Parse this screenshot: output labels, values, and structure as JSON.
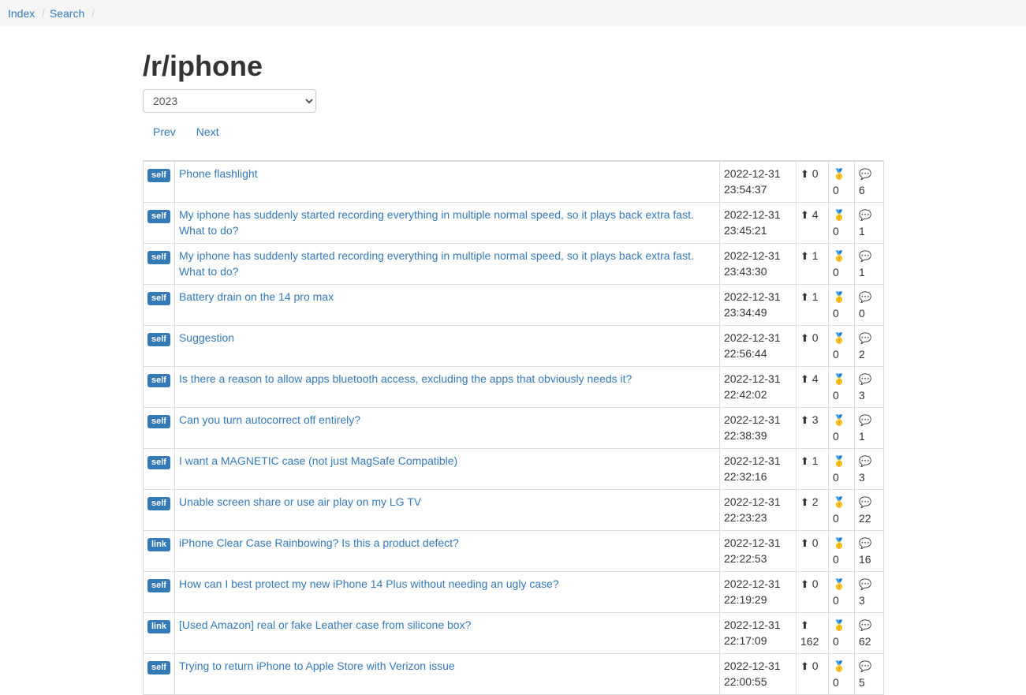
{
  "nav": {
    "index": "Index",
    "search": "Search"
  },
  "page": {
    "title": "/r/iphone",
    "year_selected": "2023",
    "prev": "Prev",
    "next": "Next"
  },
  "icons": {
    "score": "⬆",
    "awards": "🥇",
    "comments": "💬"
  },
  "posts": [
    {
      "kind": "self",
      "title": "Phone flashlight",
      "date": "2022-12-31",
      "time": "23:54:37",
      "score": "0",
      "awards": "0",
      "comments": "6"
    },
    {
      "kind": "self",
      "title": "My iphone has suddenly started recording everything in multiple normal speed, so it plays back extra fast. What to do?",
      "date": "2022-12-31",
      "time": "23:45:21",
      "score": "4",
      "awards": "0",
      "comments": "1"
    },
    {
      "kind": "self",
      "title": "My iphone has suddenly started recording everything in multiple normal speed, so it plays back extra fast. What to do?",
      "date": "2022-12-31",
      "time": "23:43:30",
      "score": "1",
      "awards": "0",
      "comments": "1"
    },
    {
      "kind": "self",
      "title": "Battery drain on the 14 pro max",
      "date": "2022-12-31",
      "time": "23:34:49",
      "score": "1",
      "awards": "0",
      "comments": "0"
    },
    {
      "kind": "self",
      "title": "Suggestion",
      "date": "2022-12-31",
      "time": "22:56:44",
      "score": "0",
      "awards": "0",
      "comments": "2"
    },
    {
      "kind": "self",
      "title": "Is there a reason to allow apps bluetooth access, excluding the apps that obviously needs it?",
      "date": "2022-12-31",
      "time": "22:42:02",
      "score": "4",
      "awards": "0",
      "comments": "3"
    },
    {
      "kind": "self",
      "title": "Can you turn autocorrect off entirely?",
      "date": "2022-12-31",
      "time": "22:38:39",
      "score": "3",
      "awards": "0",
      "comments": "1"
    },
    {
      "kind": "self",
      "title": "I want a MAGNETIC case (not just MagSafe Compatible)",
      "date": "2022-12-31",
      "time": "22:32:16",
      "score": "1",
      "awards": "0",
      "comments": "3"
    },
    {
      "kind": "self",
      "title": "Unable screen share or use air play on my LG TV",
      "date": "2022-12-31",
      "time": "22:23:23",
      "score": "2",
      "awards": "0",
      "comments": "22"
    },
    {
      "kind": "link",
      "title": "iPhone Clear Case Rainbowing? Is this a product defect?",
      "date": "2022-12-31",
      "time": "22:22:53",
      "score": "0",
      "awards": "0",
      "comments": "16"
    },
    {
      "kind": "self",
      "title": "How can I best protect my new iPhone 14 Plus without needing an ugly case?",
      "date": "2022-12-31",
      "time": "22:19:29",
      "score": "0",
      "awards": "0",
      "comments": "3"
    },
    {
      "kind": "link",
      "title": "[Used Amazon] real or fake Leather case from silicone box?",
      "date": "2022-12-31",
      "time": "22:17:09",
      "score": "162",
      "awards": "0",
      "comments": "62"
    },
    {
      "kind": "self",
      "title": "Trying to return iPhone to Apple Store with Verizon issue",
      "date": "2022-12-31",
      "time": "22:00:55",
      "score": "0",
      "awards": "0",
      "comments": "5"
    }
  ]
}
